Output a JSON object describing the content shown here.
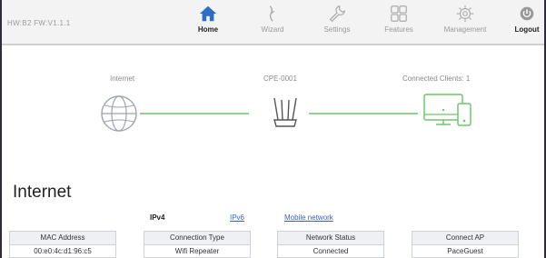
{
  "header": {
    "firmware": "HW:B2 FW:V1.1.1",
    "nav": [
      {
        "label": "Home",
        "icon": "home-icon",
        "active": true
      },
      {
        "label": "Wizard",
        "icon": "wand-icon",
        "active": false
      },
      {
        "label": "Settings",
        "icon": "wrench-icon",
        "active": false
      },
      {
        "label": "Features",
        "icon": "grid-icon",
        "active": false
      },
      {
        "label": "Management",
        "icon": "gear-icon",
        "active": false
      },
      {
        "label": "Logout",
        "icon": "power-icon",
        "active": false
      }
    ]
  },
  "diagram": {
    "internet_label": "Internet",
    "device_label": "CPE-0001",
    "clients_label": "Connected Clients: 1"
  },
  "internet": {
    "title": "Internet",
    "tabs": [
      {
        "label": "IPv4",
        "active": true
      },
      {
        "label": "IPv6",
        "active": false
      },
      {
        "label": "Mobile network",
        "active": false
      }
    ],
    "columns": [
      {
        "header": "MAC Address",
        "value": "00:e0:4c:d1:96:c5"
      },
      {
        "header": "Connection Type",
        "value": "Wifi Repeater"
      },
      {
        "header": "Network Status",
        "value": "Connected"
      },
      {
        "header": "Connect AP",
        "value": "PaceGuest"
      }
    ]
  },
  "colors": {
    "accent": "#2a6fc4",
    "link_line": "#8fd18f",
    "client_green": "#6cc86c"
  }
}
